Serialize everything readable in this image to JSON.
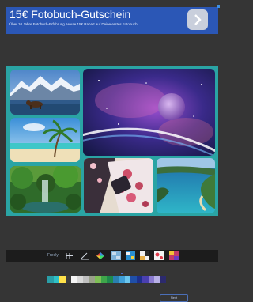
{
  "ad": {
    "title": "15€ Fotobuch-Gutschein",
    "subtitle": "Über 10 Jahre Fotobuch-Erfahrung. Heute 15€ Rabatt auf Deine erstes Fotobuch",
    "next_icon": "chevron-right-icon",
    "page_dots": 2,
    "active_dot": 0,
    "colors": {
      "background": "#2b57b6",
      "button": "#c9cfdc"
    }
  },
  "collage": {
    "background_color": "#2aa4a4",
    "photos": [
      "mountains-bear-photo",
      "galaxy-moon-photo",
      "tropical-beach-photo",
      "jungle-waterfall-photo",
      "flowers-fabric-photo",
      "coastline-photo"
    ]
  },
  "toolbar": {
    "label": "Freely",
    "tools": [
      "layout-icon",
      "edit-icon",
      "color-wheel-icon",
      "pattern-icon",
      "grid-pattern-icon",
      "frame-pattern-icon",
      "flower-pattern-icon",
      "mosaic-pattern-icon"
    ]
  },
  "palette": {
    "colors": [
      "#2a9fa8",
      "#2ec0c6",
      "#ffe24a",
      "#3d3d3d",
      "#f5f5f5",
      "#d9d9d9",
      "#bfbfbf",
      "#9aa08a",
      "#7fbf56",
      "#3ea64a",
      "#1f8a4c",
      "#2a7fb0",
      "#3f9fd8",
      "#6ac6ee",
      "#1f4fa8",
      "#1d2f8c",
      "#4a3fb0",
      "#8a7ad0",
      "#b8b0e6",
      "#2c2a6e"
    ]
  },
  "bottom_button": {
    "label": "Next"
  }
}
